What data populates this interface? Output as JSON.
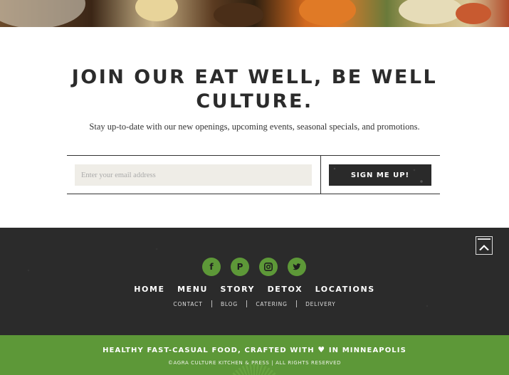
{
  "hero": {
    "image_description_icon": "food-photo"
  },
  "signup": {
    "title_line1": "JOIN OUR EAT WELL, BE WELL",
    "title_line2": "CULTURE.",
    "subtitle": "Stay up-to-date with our new openings, upcoming events, seasonal specials, and promotions.",
    "email_placeholder": "Enter your email address",
    "email_value": "",
    "button_label": "SIGN ME UP!"
  },
  "footer": {
    "back_to_top_icon": "chevron-up-icon",
    "social": [
      {
        "icon": "facebook-icon",
        "glyph": "f"
      },
      {
        "icon": "pinterest-icon",
        "glyph": "P"
      },
      {
        "icon": "instagram-icon",
        "glyph": ""
      },
      {
        "icon": "twitter-icon",
        "glyph": ""
      }
    ],
    "main_nav": [
      "HOME",
      "MENU",
      "STORY",
      "DETOX",
      "LOCATIONS"
    ],
    "sub_nav": [
      "CONTACT",
      "BLOG",
      "CATERING",
      "DELIVERY"
    ],
    "tagline_before": "HEALTHY FAST-CASUAL FOOD, CRAFTED WITH",
    "tagline_heart_icon": "heart-icon",
    "tagline_after": "IN MINNEAPOLIS",
    "copyright": "©AGRA CULTURE KITCHEN & PRESS | ALL RIGHTS RESERVED"
  },
  "colors": {
    "brand_green": "#5d9838",
    "footer_dark": "#2b2b2b",
    "button_dark": "#2a2a2a",
    "input_bg": "#efede7"
  }
}
